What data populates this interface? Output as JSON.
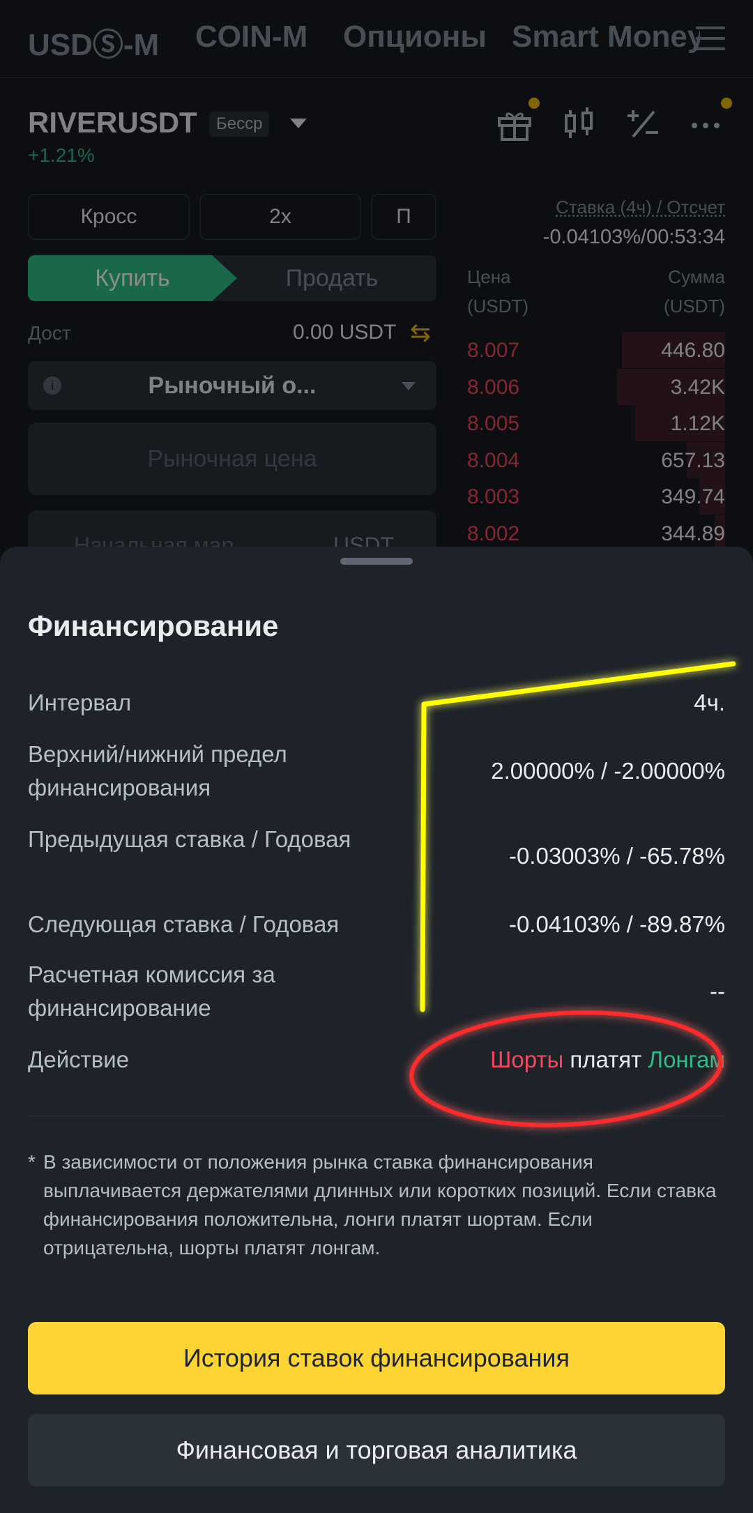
{
  "top_tabs": [
    "USDⓈ-M",
    "COIN-M",
    "Опционы",
    "Smart Money"
  ],
  "symbol": {
    "name": "RIVERUSDT",
    "badge": "Бесср",
    "change": "+1.21%"
  },
  "controls": {
    "margin_mode": "Кросс",
    "leverage": "2x",
    "third": "П"
  },
  "trade": {
    "buy": "Купить",
    "sell": "Продать",
    "avail_label": "Дост",
    "avail_value": "0.00 USDT",
    "order_type": "Рыночный о...",
    "market_price": "Рыночная цена",
    "initial_margin": "Начальная мар",
    "margin_currency": "USDT"
  },
  "funding_header": {
    "label": "Ставка (4ч) / Отсчет",
    "value": "-0.04103%/00:53:34"
  },
  "orderbook": {
    "price_header": [
      "Цена",
      "(USDT)"
    ],
    "amount_header": [
      "Сумма",
      "(USDT)"
    ],
    "rows": [
      {
        "price": "8.007",
        "amount": "446.80",
        "depth": 0.4
      },
      {
        "price": "8.006",
        "amount": "3.42K",
        "depth": 0.42
      },
      {
        "price": "8.005",
        "amount": "1.12K",
        "depth": 0.35
      },
      {
        "price": "8.004",
        "amount": "657.13",
        "depth": 0.15
      },
      {
        "price": "8.003",
        "amount": "349.74",
        "depth": 0.1
      },
      {
        "price": "8.002",
        "amount": "344.89",
        "depth": 0.04
      }
    ]
  },
  "sheet": {
    "title": "Финансирование",
    "rows": [
      {
        "label": "Интервал",
        "value": "4ч."
      },
      {
        "label": "Верхний/нижний предел финансирования",
        "value": "2.00000% / -2.00000%"
      },
      {
        "label": "Предыдущая ставка / Годовая",
        "value": "-0.03003% / -65.78%"
      },
      {
        "label": "Следующая ставка / Годовая",
        "value": "-0.04103% / -89.87%"
      },
      {
        "label": "Расчетная комиссия за финансирование",
        "value": "--"
      }
    ],
    "action": {
      "label": "Действие",
      "short": "Шорты",
      "verb": "платят",
      "long": "Лонгам"
    },
    "note_star": "*",
    "note": "В зависимости от положения рынка ставка финансирования выплачивается держателями длинных или коротких позиций. Если ставка финансирования положительна, лонги платят шортам. Если отрицательна, шорты платят лонгам.",
    "btn_history": "История ставок финансирования",
    "btn_analytics": "Финансовая и торговая аналитика"
  },
  "colors": {
    "buy": "#2ebd85",
    "sell": "#f6465d",
    "accent": "#fcd535",
    "annotation_yellow": "#ffff00",
    "annotation_red": "#ff2a2a"
  }
}
